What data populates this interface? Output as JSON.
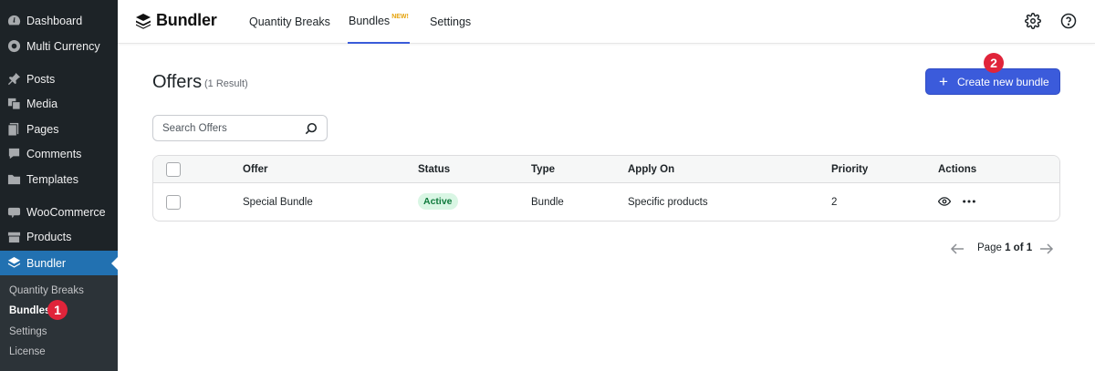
{
  "sidebar": {
    "items": [
      {
        "label": "Dashboard",
        "icon": "dashboard-icon"
      },
      {
        "label": "Multi Currency",
        "icon": "currency-icon"
      },
      {
        "label": "Posts",
        "icon": "pin-icon"
      },
      {
        "label": "Media",
        "icon": "media-icon"
      },
      {
        "label": "Pages",
        "icon": "pages-icon"
      },
      {
        "label": "Comments",
        "icon": "comment-icon"
      },
      {
        "label": "Templates",
        "icon": "folder-icon"
      },
      {
        "label": "WooCommerce",
        "icon": "woocommerce-icon"
      },
      {
        "label": "Products",
        "icon": "box-icon"
      },
      {
        "label": "Bundler",
        "icon": "layers-icon",
        "active": true
      }
    ],
    "submenu": [
      "Quantity Breaks",
      "Bundles",
      "Settings",
      "License"
    ],
    "current_sub": "Bundles"
  },
  "badges": {
    "one": "1",
    "two": "2"
  },
  "topbar": {
    "brand": "Bundler",
    "nav": [
      {
        "label": "Quantity Breaks"
      },
      {
        "label": "Bundles",
        "tag": "NEW!",
        "active": true
      },
      {
        "label": "Settings"
      }
    ],
    "icons": [
      "settings-gear-icon",
      "help-icon"
    ]
  },
  "page": {
    "title": "Offers",
    "result_count": "(1 Result)",
    "create_button": "Create new bundle",
    "create_plus": "+",
    "search_placeholder": "Search Offers"
  },
  "table": {
    "columns": [
      "Offer",
      "Status",
      "Type",
      "Apply On",
      "Priority",
      "Actions"
    ],
    "rows": [
      {
        "offer": "Special Bundle",
        "status": "Active",
        "type": "Bundle",
        "apply_on": "Specific products",
        "priority": "2"
      }
    ]
  },
  "pagination": {
    "prefix": "Page",
    "current": "1",
    "of": "of",
    "total": "1"
  },
  "colors": {
    "accent": "#3b5bdb",
    "wp_sidebar": "#1d2327",
    "wp_active": "#2271b1",
    "badge": "#e0243a",
    "status_active_bg": "#d9f6e4",
    "new_tag": "#e5a20a"
  }
}
